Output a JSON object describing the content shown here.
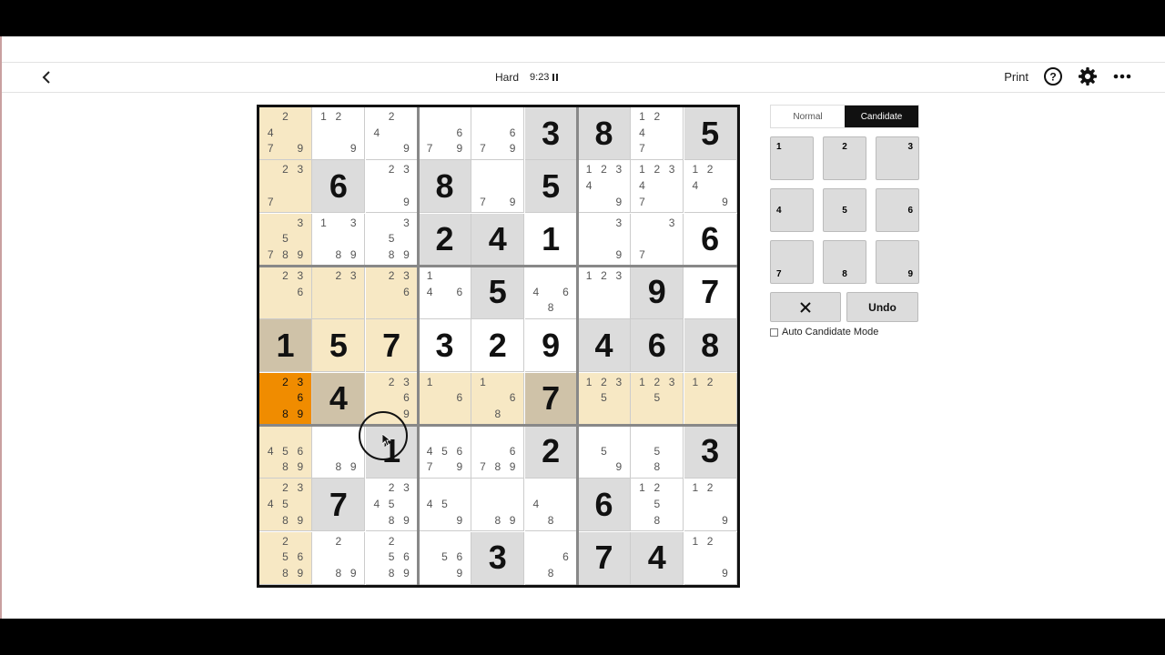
{
  "header": {
    "difficulty": "Hard",
    "timer": "9:23",
    "print_label": "Print",
    "icons": [
      "back-icon",
      "pause-icon",
      "help-icon",
      "gear-icon",
      "more-icon"
    ]
  },
  "panel": {
    "normal_label": "Normal",
    "candidate_label": "Candidate",
    "active_mode": "Candidate",
    "keys": [
      "1",
      "2",
      "3",
      "4",
      "5",
      "6",
      "7",
      "8",
      "9"
    ],
    "clear_icon": "x-icon",
    "undo_label": "Undo",
    "auto_candidate_label": "Auto Candidate Mode",
    "auto_candidate_checked": false
  },
  "colors": {
    "given_bg": "#dcdcdc",
    "highlight_bg": "#f7e8c4",
    "selected_highlight_given": "#cfc2a8",
    "selected_bg": "#f08c00",
    "white": "#ffffff"
  },
  "grid": [
    [
      {
        "c": [
          2,
          4,
          7,
          9
        ]
      },
      {
        "c": [
          1,
          2,
          9
        ]
      },
      {
        "c": [
          2,
          4,
          9
        ]
      },
      {
        "c": [
          6,
          7,
          9
        ]
      },
      {
        "c": [
          6,
          7,
          9
        ]
      },
      {
        "v": "3",
        "g": true
      },
      {
        "v": "8",
        "g": true
      },
      {
        "c": [
          1,
          2,
          4,
          7
        ]
      },
      {
        "v": "5",
        "g": true
      }
    ],
    [
      {
        "c": [
          2,
          3,
          7
        ]
      },
      {
        "v": "6",
        "g": true
      },
      {
        "c": [
          2,
          3,
          9
        ]
      },
      {
        "v": "8",
        "g": true
      },
      {
        "c": [
          7,
          9
        ]
      },
      {
        "v": "5",
        "g": true
      },
      {
        "c": [
          1,
          2,
          3,
          4,
          9
        ]
      },
      {
        "c": [
          1,
          2,
          3,
          4,
          7
        ]
      },
      {
        "c": [
          1,
          2,
          4,
          9
        ]
      }
    ],
    [
      {
        "c": [
          3,
          5,
          7,
          8,
          9
        ]
      },
      {
        "c": [
          1,
          3,
          8,
          9
        ]
      },
      {
        "c": [
          3,
          5,
          8,
          9
        ]
      },
      {
        "v": "2",
        "g": true
      },
      {
        "v": "4",
        "g": true
      },
      {
        "v": "1"
      },
      {
        "c": [
          3,
          9
        ]
      },
      {
        "c": [
          3,
          7
        ]
      },
      {
        "v": "6"
      }
    ],
    [
      {
        "c": [
          2,
          3,
          6
        ]
      },
      {
        "c": [
          2,
          3
        ]
      },
      {
        "c": [
          2,
          3,
          6
        ]
      },
      {
        "c": [
          1,
          4,
          6
        ]
      },
      {
        "v": "5",
        "g": true
      },
      {
        "c": [
          4,
          6,
          8
        ]
      },
      {
        "c": [
          1,
          2,
          3
        ]
      },
      {
        "v": "9",
        "g": true
      },
      {
        "v": "7"
      }
    ],
    [
      {
        "v": "1",
        "g": true
      },
      {
        "v": "5"
      },
      {
        "v": "7"
      },
      {
        "v": "3"
      },
      {
        "v": "2"
      },
      {
        "v": "9"
      },
      {
        "v": "4",
        "g": true
      },
      {
        "v": "6",
        "g": true
      },
      {
        "v": "8",
        "g": true
      }
    ],
    [
      {
        "c": [
          2,
          3,
          6,
          8,
          9
        ]
      },
      {
        "v": "4",
        "g": true
      },
      {
        "c": [
          2,
          3,
          6,
          9
        ]
      },
      {
        "c": [
          1,
          6
        ]
      },
      {
        "c": [
          1,
          6,
          8
        ]
      },
      {
        "v": "7",
        "g": true
      },
      {
        "c": [
          1,
          2,
          3,
          5
        ]
      },
      {
        "c": [
          1,
          2,
          3,
          5
        ]
      },
      {
        "c": [
          1,
          2
        ]
      }
    ],
    [
      {
        "c": [
          4,
          5,
          6,
          8,
          9
        ]
      },
      {
        "c": [
          8,
          9
        ]
      },
      {
        "v": "1",
        "g": true
      },
      {
        "c": [
          4,
          5,
          6,
          7,
          9
        ]
      },
      {
        "c": [
          6,
          7,
          8,
          9
        ]
      },
      {
        "v": "2",
        "g": true
      },
      {
        "c": [
          5,
          9
        ]
      },
      {
        "c": [
          5,
          8
        ]
      },
      {
        "v": "3",
        "g": true
      }
    ],
    [
      {
        "c": [
          2,
          3,
          4,
          5,
          8,
          9
        ]
      },
      {
        "v": "7",
        "g": true
      },
      {
        "c": [
          2,
          3,
          4,
          5,
          8,
          9
        ]
      },
      {
        "c": [
          4,
          5,
          9
        ]
      },
      {
        "c": [
          8,
          9
        ]
      },
      {
        "c": [
          4,
          8
        ]
      },
      {
        "v": "6",
        "g": true
      },
      {
        "c": [
          1,
          2,
          5,
          8
        ]
      },
      {
        "c": [
          1,
          2,
          9
        ]
      }
    ],
    [
      {
        "c": [
          2,
          5,
          6,
          8,
          9
        ]
      },
      {
        "c": [
          2,
          8,
          9
        ]
      },
      {
        "c": [
          2,
          5,
          6,
          8,
          9
        ]
      },
      {
        "c": [
          5,
          6,
          9
        ]
      },
      {
        "v": "3",
        "g": true
      },
      {
        "c": [
          6,
          8
        ]
      },
      {
        "v": "7",
        "g": true
      },
      {
        "v": "4",
        "g": true
      },
      {
        "c": [
          1,
          2,
          9
        ]
      }
    ]
  ],
  "selected_cell": {
    "row": 5,
    "col": 0
  }
}
